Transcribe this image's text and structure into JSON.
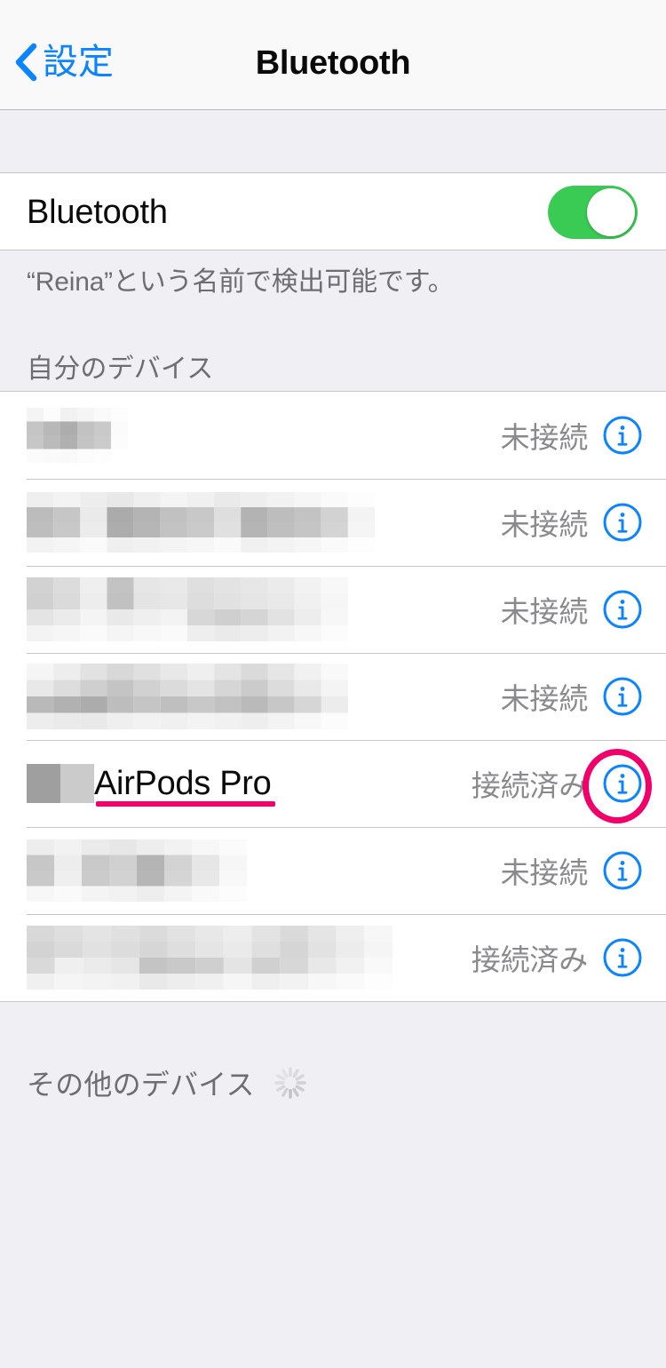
{
  "navbar": {
    "back_label": "設定",
    "back_icon": "chevron-left-icon",
    "title": "Bluetooth"
  },
  "bluetooth": {
    "label": "Bluetooth",
    "toggle_state": "on",
    "toggle_color": "#3ACB54",
    "footer_note": "“Reina”という名前で検出可能です。"
  },
  "my_devices": {
    "header": "自分のデバイス",
    "rows": [
      {
        "name": "",
        "redacted": true,
        "status": "未接続",
        "info_icon": "info-circle-icon",
        "highlighted": false
      },
      {
        "name": "",
        "redacted": true,
        "status": "未接続",
        "info_icon": "info-circle-icon",
        "highlighted": false
      },
      {
        "name": "",
        "redacted": true,
        "status": "未接続",
        "info_icon": "info-circle-icon",
        "highlighted": false
      },
      {
        "name": "",
        "redacted": true,
        "status": "未接続",
        "info_icon": "info-circle-icon",
        "highlighted": false
      },
      {
        "name": "AirPods Pro",
        "redacted": true,
        "status": "接続済み",
        "info_icon": "info-circle-icon",
        "highlighted": true
      },
      {
        "name": "",
        "redacted": true,
        "status": "未接続",
        "info_icon": "info-circle-icon",
        "highlighted": false
      },
      {
        "name": "",
        "redacted": true,
        "status": "接続済み",
        "info_icon": "info-circle-icon",
        "highlighted": false
      }
    ]
  },
  "other_devices": {
    "header": "その他のデバイス",
    "spinner_icon": "activity-spinner-icon"
  },
  "annotations": {
    "color": "#F2006A",
    "underline_target": "AirPods Pro",
    "ellipse_target": "info-circle-icon"
  },
  "colors": {
    "accent_blue": "#0A84FF",
    "toggle_green": "#3ACB54",
    "annotation_pink": "#F2006A",
    "page_background": "#EFEFF4",
    "row_background": "#FFFFFF",
    "separator": "#C6C6C8",
    "secondary_text": "#8A8A8E"
  }
}
